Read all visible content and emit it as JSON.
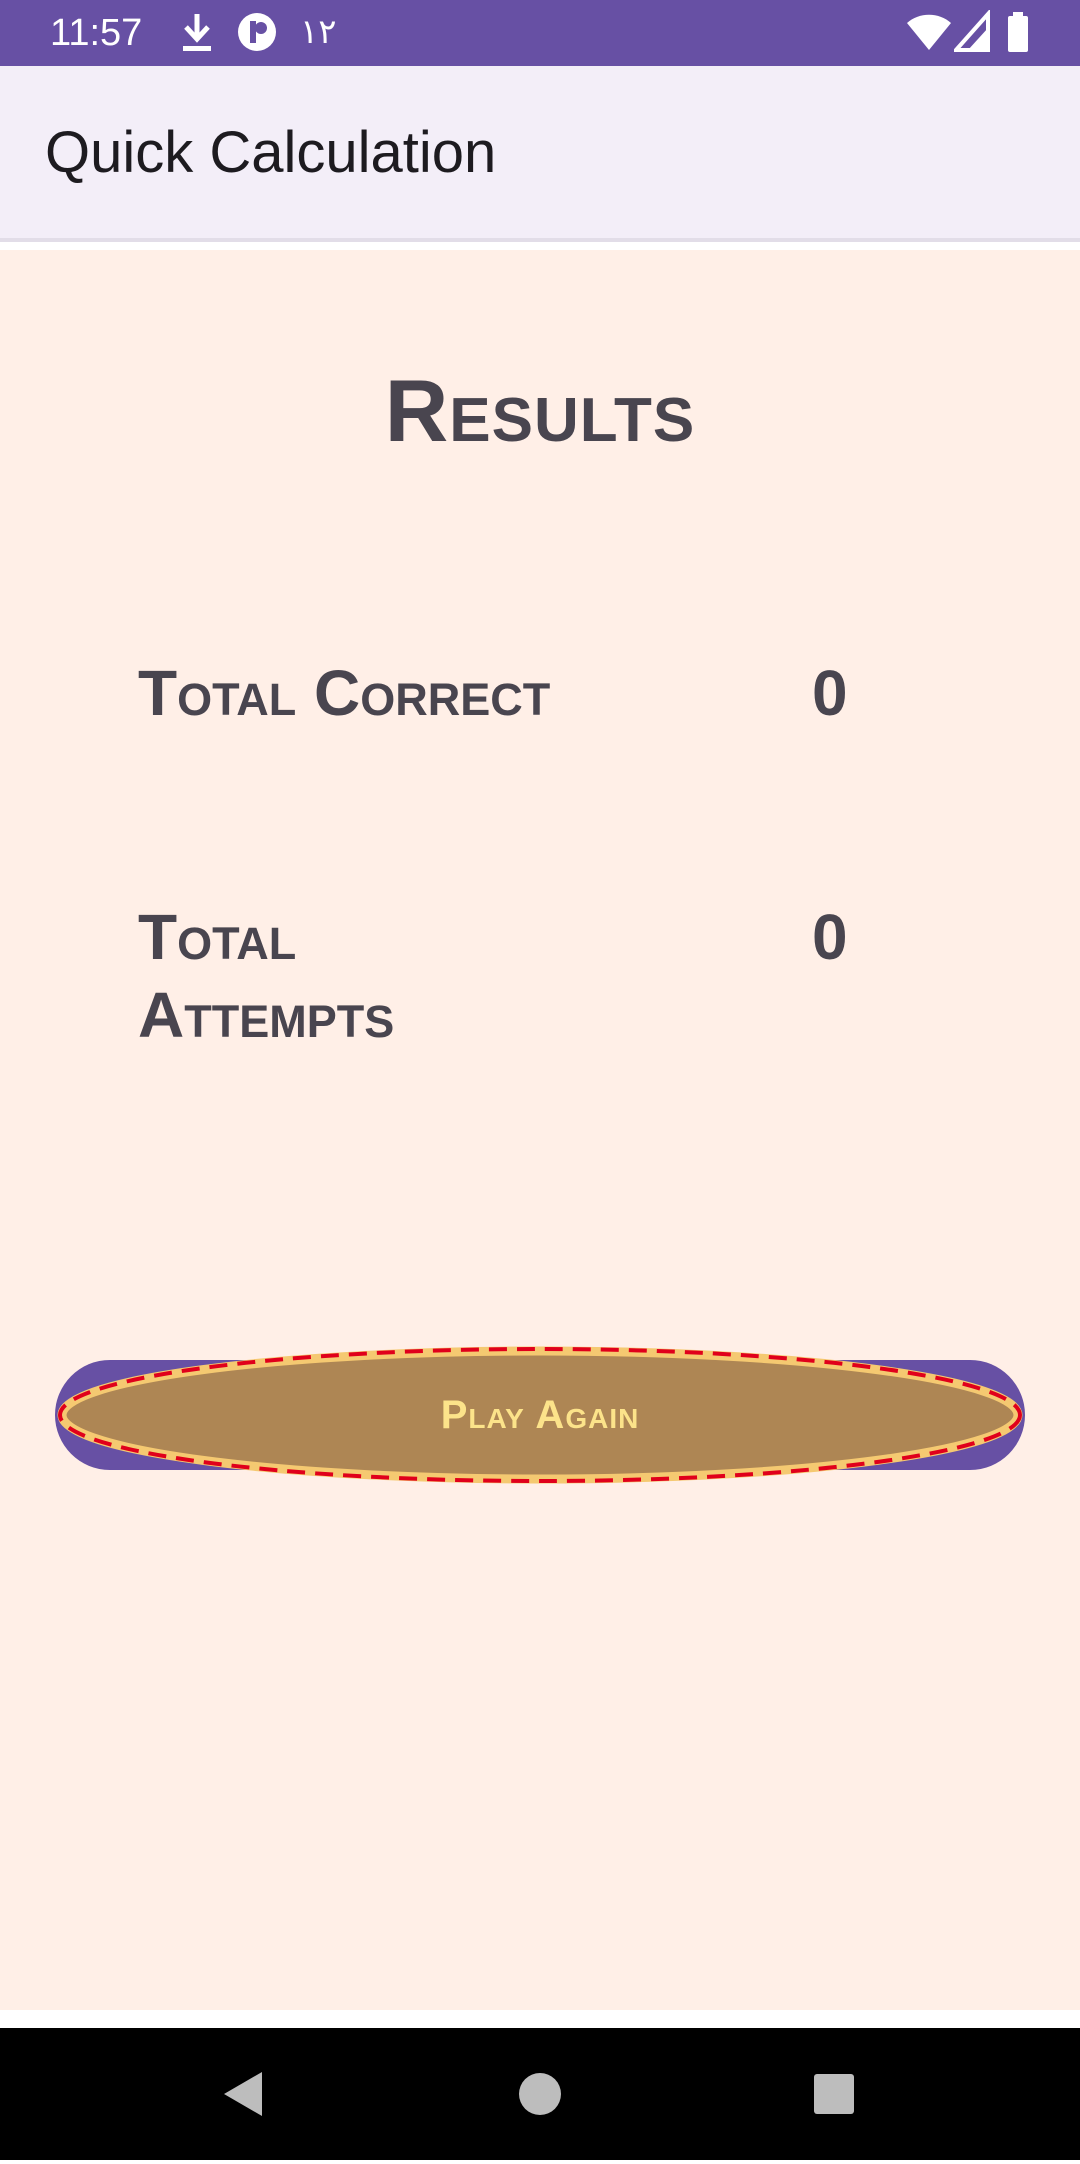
{
  "status_bar": {
    "time": "11:57",
    "notification_number": "١٢",
    "icons": [
      "download-icon",
      "app-notification-icon",
      "wifi-icon",
      "signal-icon",
      "battery-icon"
    ],
    "background_color": "#6750a4"
  },
  "app_bar": {
    "title": "Quick Calculation"
  },
  "results": {
    "title": "Results",
    "total_correct_label": "Total Correct",
    "total_correct_value": "0",
    "total_attempts_label_line1": "Total",
    "total_attempts_label_line2": "Attempts",
    "total_attempts_value": "0"
  },
  "play_button": {
    "label": "Play Again",
    "button_color": "#6750a4",
    "highlight_fill": "#ae8654",
    "highlight_border": "#f5c971",
    "dash_color": "#e0001b",
    "label_color": "#fce38a"
  },
  "content_background": "#ffefe7",
  "nav_bar": {
    "buttons": [
      "back-icon",
      "home-icon",
      "recents-icon"
    ]
  }
}
